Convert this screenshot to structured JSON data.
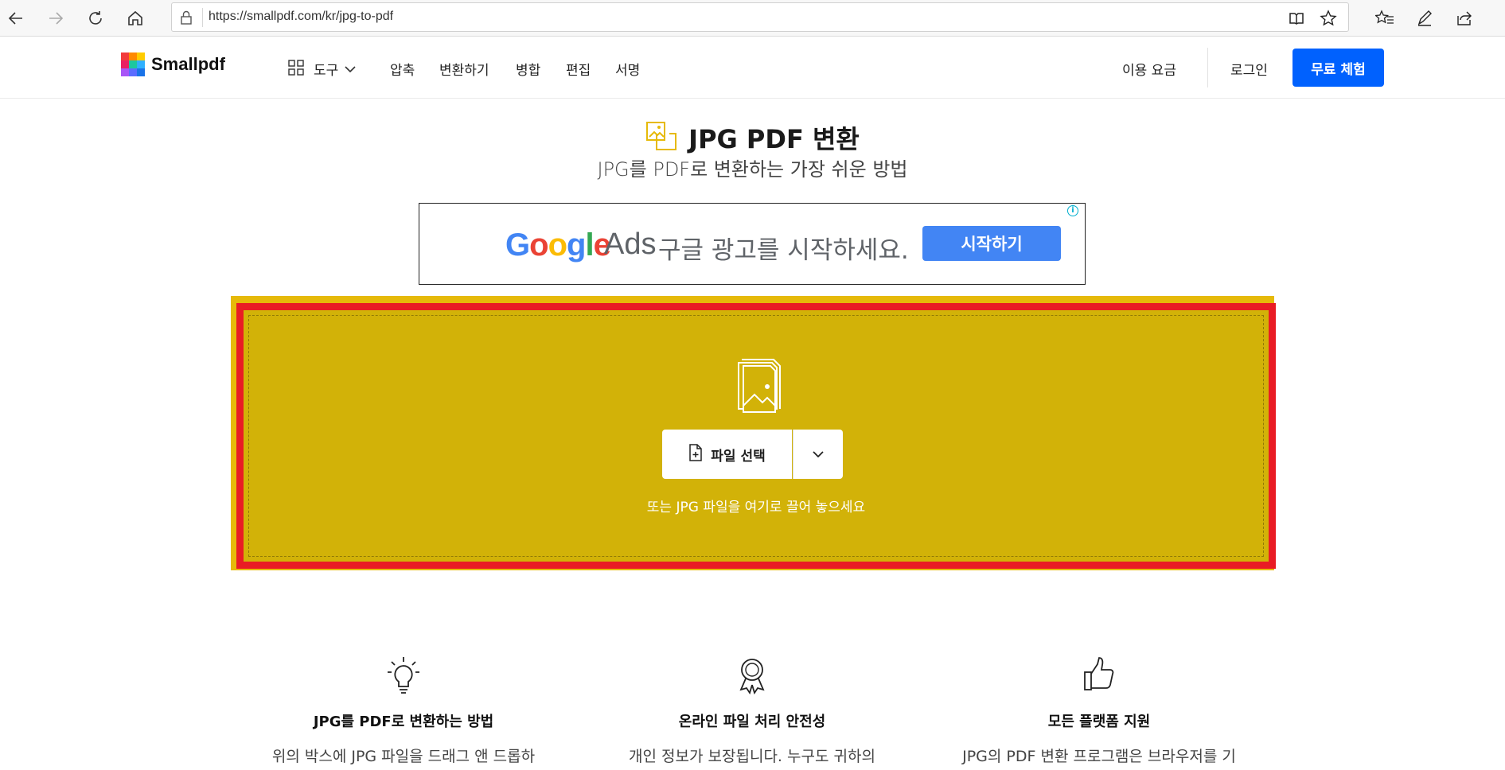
{
  "browser": {
    "url": "https://smallpdf.com/kr/jpg-to-pdf"
  },
  "header": {
    "logo_text": "Smallpdf",
    "tools_label": "도구",
    "nav": [
      "압축",
      "변환하기",
      "병합",
      "편집",
      "서명"
    ],
    "pricing": "이용 요금",
    "login": "로그인",
    "trial": "무료 체험",
    "brand_color": "#0061fe"
  },
  "hero": {
    "title": "JPG PDF 변환",
    "subtitle": "JPG를 PDF로 변환하는 가장 쉬운 방법"
  },
  "ad": {
    "google": "Google",
    "ads": "Ads",
    "text": "구글 광고를 시작하세요.",
    "cta": "시작하기",
    "info": "i"
  },
  "dropzone": {
    "choose_file": "파일 선택",
    "hint": "또는 JPG 파일을 여기로 끌어 놓으세요",
    "background_color": "#d2b208",
    "highlight_color": "#e91c24"
  },
  "features": [
    {
      "icon": "lightbulb-icon",
      "title": "JPG를 PDF로 변환하는 방법",
      "desc": "위의 박스에 JPG 파일을 드래그 앤 드롭하"
    },
    {
      "icon": "award-ribbon-icon",
      "title": "온라인 파일 처리 안전성",
      "desc": "개인 정보가 보장됩니다. 누구도 귀하의"
    },
    {
      "icon": "thumbs-up-icon",
      "title": "모든 플랫폼 지원",
      "desc": "JPG의 PDF 변환 프로그램은 브라우저를 기"
    }
  ]
}
